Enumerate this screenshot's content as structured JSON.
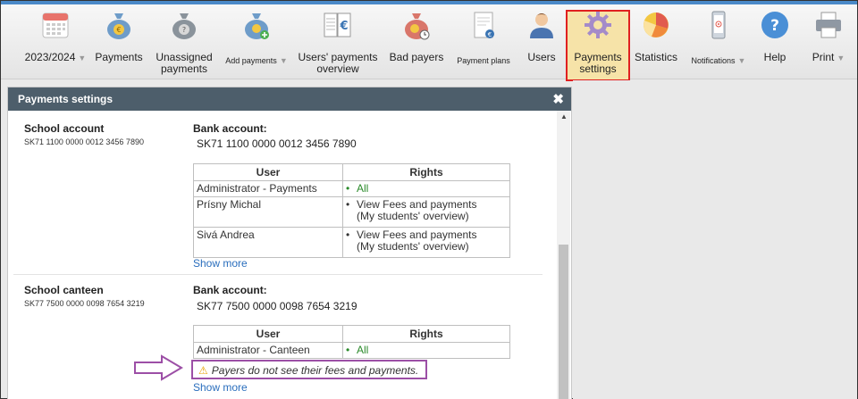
{
  "toolbar": {
    "items": [
      {
        "label": "2023/2024",
        "icon": "calendar-icon",
        "dropdown": true
      },
      {
        "label": "Payments",
        "icon": "money-bag-euro-icon"
      },
      {
        "label": "Unassigned payments",
        "icon": "money-bag-question-icon"
      },
      {
        "label": "Add payments",
        "icon": "money-bag-add-icon",
        "dropdown": true
      },
      {
        "label": "Users' payments overview",
        "icon": "ledger-euro-icon"
      },
      {
        "label": "Bad payers",
        "icon": "money-bag-clock-icon"
      },
      {
        "label": "Payment plans",
        "icon": "document-euro-icon"
      },
      {
        "label": "Users",
        "icon": "user-icon"
      },
      {
        "label": "Payments settings",
        "icon": "gear-icon",
        "active": true
      },
      {
        "label": "Statistics",
        "icon": "pie-chart-icon"
      },
      {
        "label": "Notifications",
        "icon": "phone-icon",
        "dropdown": true
      },
      {
        "label": "Help",
        "icon": "help-icon"
      },
      {
        "label": "Print",
        "icon": "printer-icon",
        "dropdown": true
      }
    ],
    "dropdown_glyph": "▼"
  },
  "panel": {
    "title": "Payments settings",
    "close_glyph": "✖"
  },
  "accounts": [
    {
      "name": "School account",
      "iban": "SK71 1100 0000 0012 3456 7890",
      "bank_label": "Bank account:",
      "bank_value": "SK71 1100 0000 0012 3456 7890",
      "columns": [
        "User",
        "Rights"
      ],
      "rows": [
        {
          "user": "Administrator - Payments",
          "rights": [
            "All"
          ]
        },
        {
          "user": "Prísny Michal",
          "rights": [
            "View Fees and payments (My students' overview)"
          ]
        },
        {
          "user": "Sivá Andrea",
          "rights": [
            "View Fees and payments (My students' overview)"
          ]
        }
      ],
      "show_more": "Show more"
    },
    {
      "name": "School canteen",
      "iban": "SK77 7500 0000 0098 7654 3219",
      "bank_label": "Bank account:",
      "bank_value": "SK77 7500 0000 0098 7654 3219",
      "columns": [
        "User",
        "Rights"
      ],
      "rows": [
        {
          "user": "Administrator - Canteen",
          "rights": [
            "All"
          ]
        }
      ],
      "warning": "Payers do not see their fees and payments.",
      "show_more": "Show more"
    }
  ],
  "colors": {
    "accent_blue": "#4a89c8",
    "panel_header": "#4d5e6b",
    "highlight_red": "#e02020",
    "highlight_fill": "#f6e3a8",
    "annotation_purple": "#9c4fa6",
    "link_blue": "#2a6ebd",
    "green": "#2a8a2a"
  }
}
